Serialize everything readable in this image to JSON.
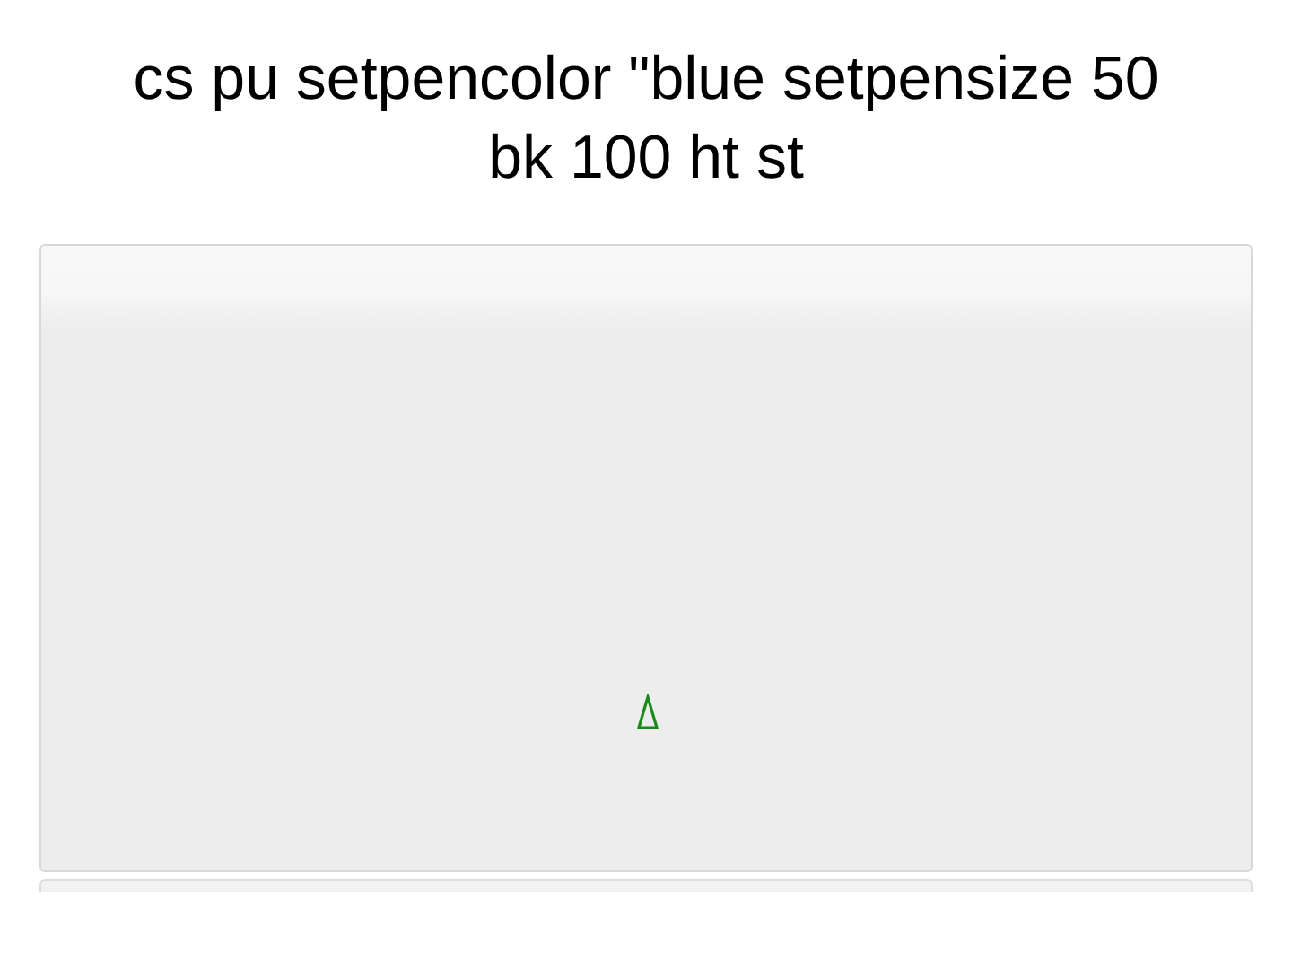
{
  "title": "cs pu setpencolor \"blue setpensize 50 bk 100 ht st"
}
